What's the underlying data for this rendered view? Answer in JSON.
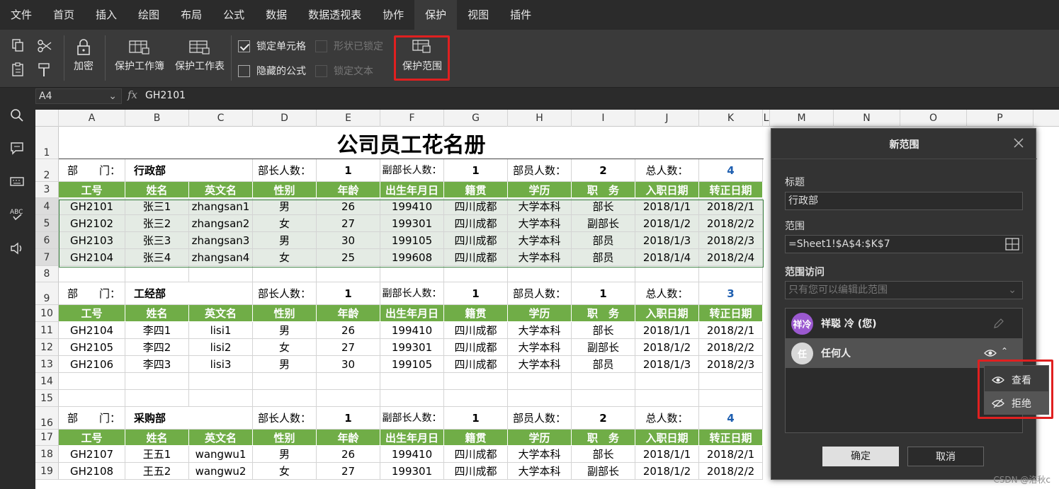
{
  "menu": {
    "tabs": [
      "文件",
      "首页",
      "插入",
      "绘图",
      "布局",
      "公式",
      "数据",
      "数据透视表",
      "协作",
      "保护",
      "视图",
      "插件"
    ],
    "active": "保护"
  },
  "ribbon": {
    "encrypt": "加密",
    "protect_workbook": "保护工作簿",
    "protect_sheet": "保护工作表",
    "lock_cells": "锁定单元格",
    "hidden_formula": "隐藏的公式",
    "shape_locked": "形状已锁定",
    "lock_text": "锁定文本",
    "protect_range": "保护范围"
  },
  "formula_bar": {
    "name_box": "A4",
    "fx": "fx",
    "value": "GH2101"
  },
  "columns": [
    "A",
    "B",
    "C",
    "D",
    "E",
    "F",
    "G",
    "H",
    "I",
    "J",
    "K",
    "L",
    "M",
    "N",
    "O",
    "P"
  ],
  "sheet": {
    "title": "公司员工花名册",
    "headers": [
      "工号",
      "姓名",
      "英文名",
      "性别",
      "年龄",
      "出生年月日",
      "籍贯",
      "学历",
      "职　务",
      "入职日期",
      "转正日期"
    ],
    "labels": {
      "dept": "部　　门：",
      "heads": "部长人数：",
      "deputy": "副部长人数：",
      "members": "部员人数：",
      "total": "总人数："
    },
    "departments": [
      {
        "name": "行政部",
        "heads": "1",
        "deputy": "1",
        "members": "2",
        "total": "4",
        "header_row": "3",
        "rows": [
          {
            "r": "4",
            "cells": [
              "GH2101",
              "张三1",
              "zhangsan1",
              "男",
              "26",
              "199410",
              "四川成都",
              "大学本科",
              "部长",
              "2018/1/1",
              "2018/2/1"
            ]
          },
          {
            "r": "5",
            "cells": [
              "GH2102",
              "张三2",
              "zhangsan2",
              "女",
              "27",
              "199301",
              "四川成都",
              "大学本科",
              "副部长",
              "2018/1/2",
              "2018/2/2"
            ]
          },
          {
            "r": "6",
            "cells": [
              "GH2103",
              "张三3",
              "zhangsan3",
              "男",
              "30",
              "199105",
              "四川成都",
              "大学本科",
              "部员",
              "2018/1/3",
              "2018/2/3"
            ]
          },
          {
            "r": "7",
            "cells": [
              "GH2104",
              "张三4",
              "zhangsan4",
              "女",
              "25",
              "199608",
              "四川成都",
              "大学本科",
              "部员",
              "2018/1/4",
              "2018/2/4"
            ]
          }
        ]
      },
      {
        "name": "工经部",
        "heads": "1",
        "deputy": "1",
        "members": "1",
        "total": "3",
        "header_row": "10",
        "rows": [
          {
            "r": "11",
            "cells": [
              "GH2104",
              "李四1",
              "lisi1",
              "男",
              "26",
              "199410",
              "四川成都",
              "大学本科",
              "部长",
              "2018/1/1",
              "2018/2/1"
            ]
          },
          {
            "r": "12",
            "cells": [
              "GH2105",
              "李四2",
              "lisi2",
              "女",
              "27",
              "199301",
              "四川成都",
              "大学本科",
              "副部长",
              "2018/1/2",
              "2018/2/2"
            ]
          },
          {
            "r": "13",
            "cells": [
              "GH2106",
              "李四3",
              "lisi3",
              "男",
              "30",
              "199105",
              "四川成都",
              "大学本科",
              "部员",
              "2018/1/3",
              "2018/2/3"
            ]
          }
        ]
      },
      {
        "name": "采购部",
        "heads": "1",
        "deputy": "1",
        "members": "2",
        "total": "4",
        "header_row": "17",
        "rows": [
          {
            "r": "18",
            "cells": [
              "GH2107",
              "王五1",
              "wangwu1",
              "男",
              "26",
              "199410",
              "四川成都",
              "大学本科",
              "部长",
              "2018/1/1",
              "2018/2/1"
            ]
          },
          {
            "r": "19",
            "cells": [
              "GH2108",
              "王五2",
              "wangwu2",
              "女",
              "27",
              "199301",
              "四川成都",
              "大学本科",
              "副部长",
              "2018/1/2",
              "2018/2/2"
            ]
          }
        ]
      }
    ],
    "row_numbers": [
      "1",
      "2",
      "3",
      "4",
      "5",
      "6",
      "7",
      "8",
      "9",
      "10",
      "11",
      "12",
      "13",
      "14",
      "15",
      "16",
      "17",
      "18",
      "19"
    ]
  },
  "panel": {
    "title": "新范围",
    "label_title": "标题",
    "title_value": "行政部",
    "label_range": "范围",
    "range_value": "=Sheet1!$A$4:$K$7",
    "label_access": "范围访问",
    "access_value": "只有您可以编辑此范围",
    "users": [
      {
        "avatar": "祥冷",
        "name": "祥聪 冷 (您)",
        "color": "#9b59d0"
      },
      {
        "avatar": "任",
        "name": "任何人",
        "color": "#d8d8d8"
      }
    ],
    "ok": "确定",
    "cancel": "取消"
  },
  "dropdown": {
    "view": "查看",
    "deny": "拒绝"
  },
  "watermark": "CSDN @洛秋c"
}
